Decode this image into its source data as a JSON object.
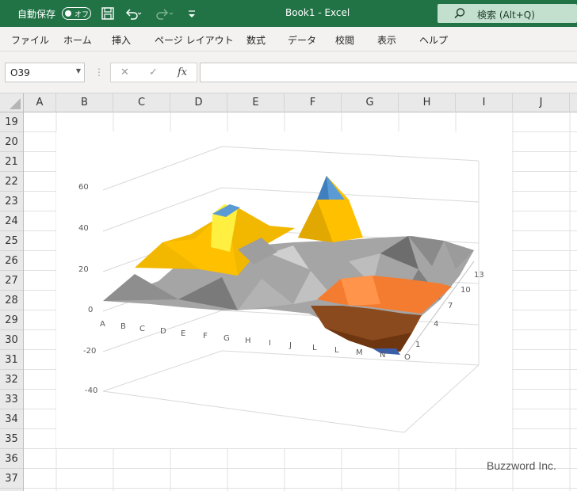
{
  "titlebar": {
    "autosave_label": "自動保存",
    "autosave_state": "オフ",
    "doc_title": "Book1  -  Excel",
    "search_placeholder": "検索 (Alt+Q)",
    "icons": [
      "save-icon",
      "undo-icon",
      "redo-icon",
      "customize-icon",
      "search-icon"
    ]
  },
  "menu": {
    "items": [
      "ファイル",
      "ホーム",
      "挿入",
      "ページ レイアウト",
      "数式",
      "データ",
      "校閲",
      "表示",
      "ヘルプ"
    ]
  },
  "formula_bar": {
    "name_box": "O39",
    "cancel": "✕",
    "enter": "✓",
    "fx": "fx",
    "formula": ""
  },
  "sheet": {
    "columns": [
      "A",
      "B",
      "C",
      "D",
      "E",
      "F",
      "G",
      "H",
      "I",
      "J"
    ],
    "rows": [
      "19",
      "20",
      "21",
      "22",
      "23",
      "24",
      "25",
      "26",
      "27",
      "28",
      "29",
      "30",
      "31",
      "32",
      "33",
      "34",
      "35",
      "36",
      "37"
    ]
  },
  "chart_data": {
    "type": "surface",
    "x_categories": [
      "A",
      "B",
      "C",
      "D",
      "E",
      "F",
      "G",
      "H",
      "I",
      "J",
      "L",
      "L",
      "M",
      "N",
      "O"
    ],
    "y_labels": [
      "1",
      "4",
      "7",
      "10",
      "13"
    ],
    "z_ticks": [
      "60",
      "40",
      "20",
      "0",
      "-20",
      "-40"
    ],
    "z_range": [
      -40,
      60
    ],
    "band_colors": {
      "-40_-20": "#3b5ea8",
      "-20_0": "#8a4a1e",
      "0_20": "#f47c30",
      "20_40": "#a5a5a5",
      "40_60": "#ffc000",
      "60_80": "#5b9bd5"
    }
  },
  "watermark": "Buzzword Inc."
}
